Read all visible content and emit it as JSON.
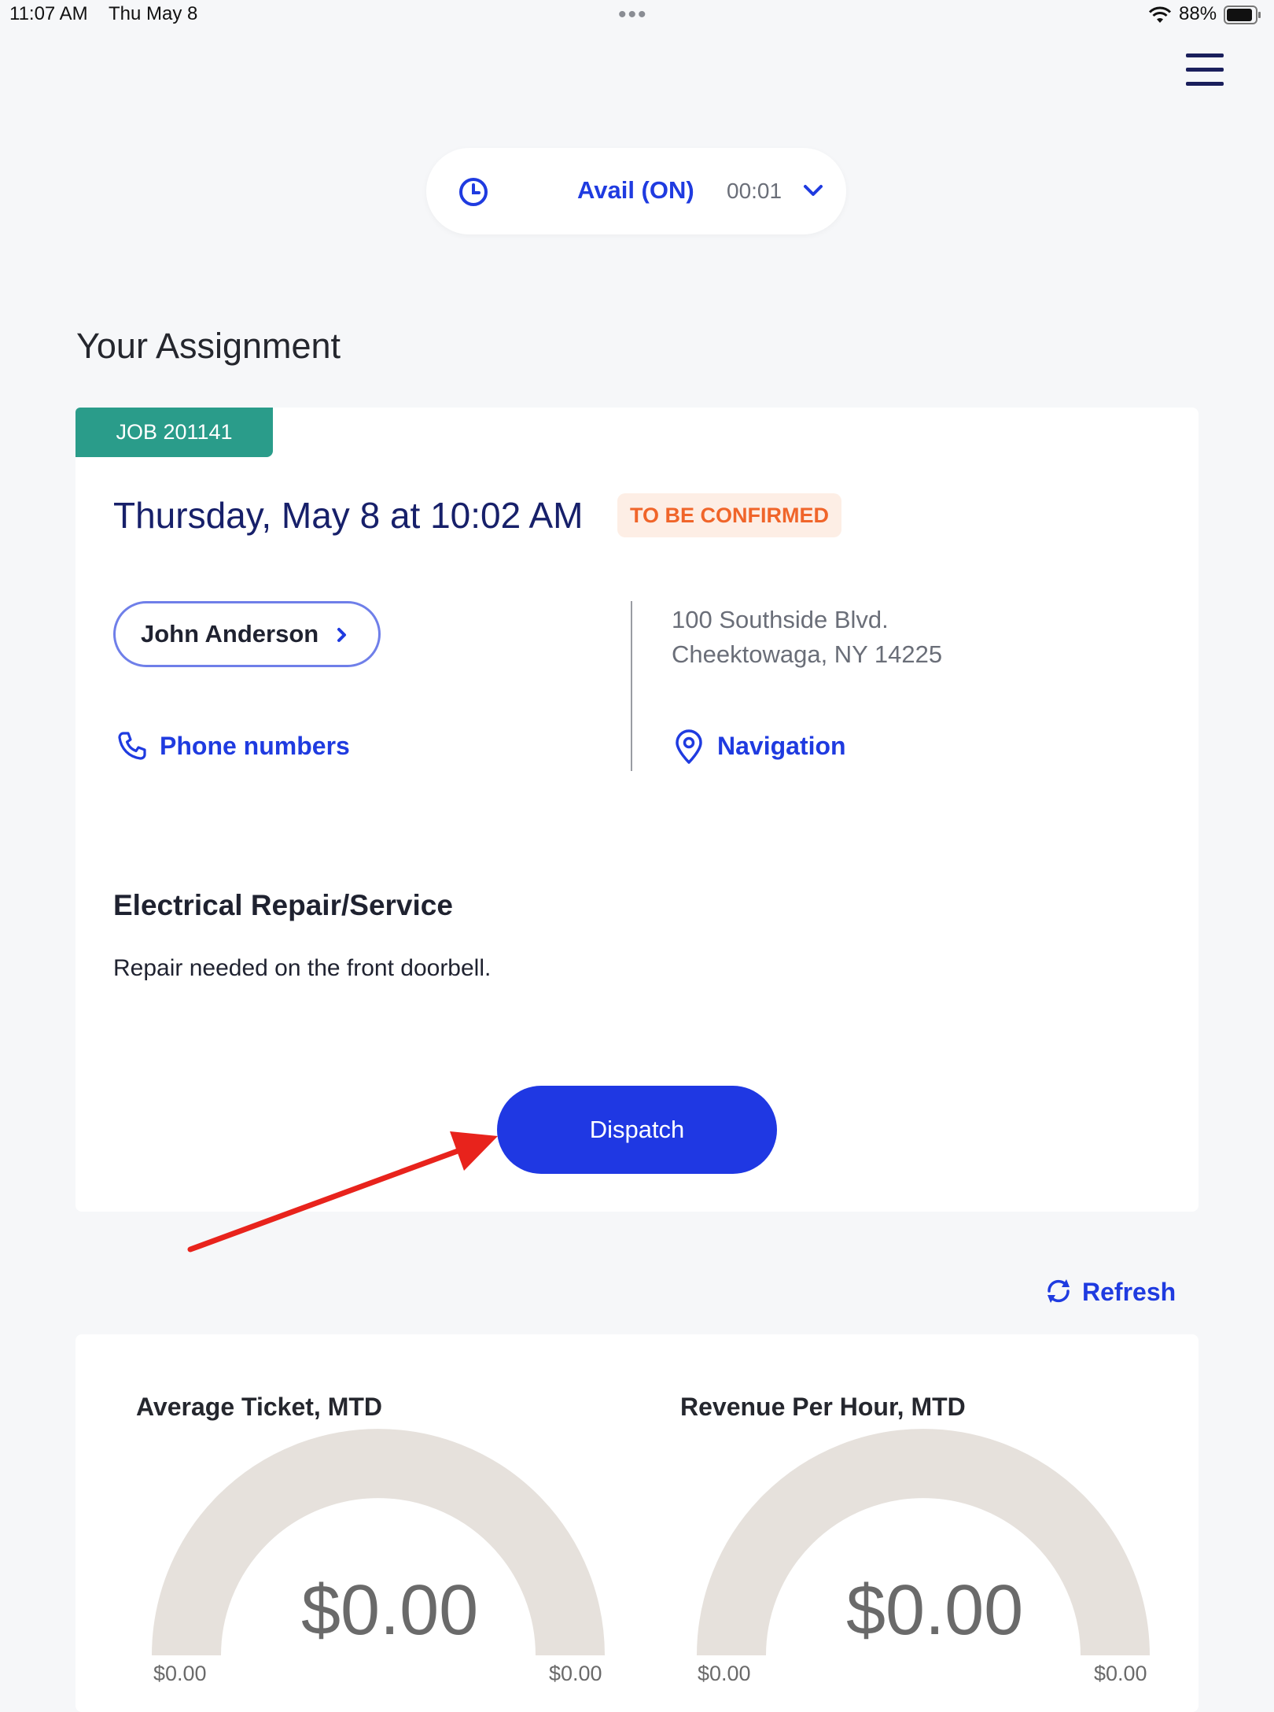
{
  "status_bar": {
    "time": "11:07 AM",
    "date": "Thu May 8",
    "dots": "•••",
    "battery_pct": "88%"
  },
  "availability": {
    "status": "Avail (ON)",
    "timer": "00:01"
  },
  "section_title": "Your Assignment",
  "assignment": {
    "job_tag": "JOB 201141",
    "date": "Thursday, May 8 at 10:02 AM",
    "status_badge": "TO BE CONFIRMED",
    "customer_name": "John Anderson",
    "address_line1": "100 Southside Blvd.",
    "address_line2": "Cheektowaga, NY 14225",
    "phone_link": "Phone numbers",
    "navigation_link": "Navigation",
    "service_title": "Electrical Repair/Service",
    "service_description": "Repair needed on the front doorbell.",
    "dispatch_label": "Dispatch"
  },
  "refresh_label": "Refresh",
  "metrics": [
    {
      "title": "Average Ticket, MTD",
      "value": "$0.00",
      "min": "$0.00",
      "max": "$0.00"
    },
    {
      "title": "Revenue Per Hour, MTD",
      "value": "$0.00",
      "min": "$0.00",
      "max": "$0.00"
    }
  ],
  "colors": {
    "accent_blue": "#1f38e3",
    "teal": "#2a9c8a",
    "badge_orange": "#f0652a",
    "gauge_track": "#e6e1dc",
    "annotation_arrow": "#e8231c"
  },
  "icons": {
    "clock": "clock-icon",
    "chevron_down": "chevron-down-icon",
    "chevron_right": "chevron-right-icon",
    "phone": "phone-icon",
    "pin": "location-pin-icon",
    "refresh": "refresh-icon",
    "menu": "hamburger-menu-icon"
  }
}
